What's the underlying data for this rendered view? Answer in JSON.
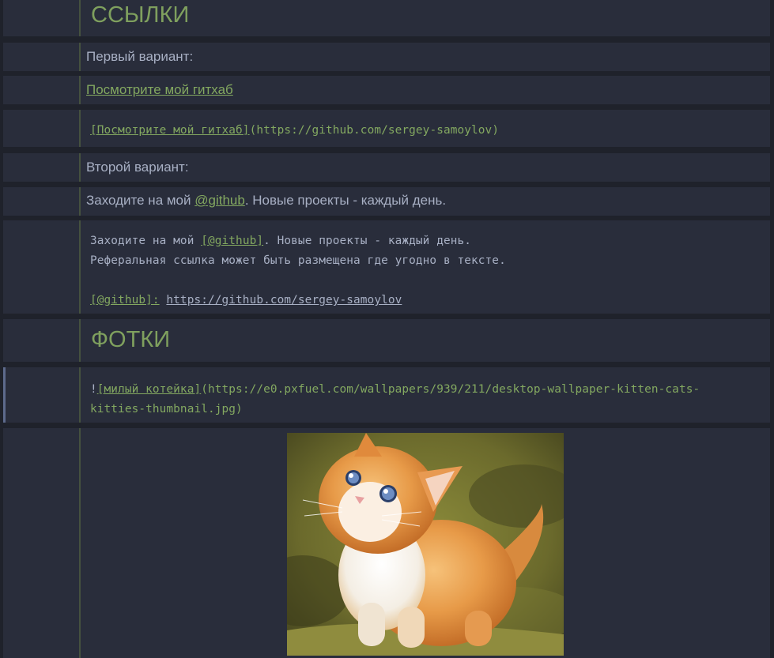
{
  "sections": {
    "links_heading": "ССЫЛКИ",
    "photos_heading": "ФОТКИ"
  },
  "links": {
    "variant1_label": "Первый вариант:",
    "variant1_link_text": "Посмотрите мой гитхаб",
    "variant1_code_link": "[Посмотрите мой гитхаб]",
    "variant1_code_url": "(https://github.com/sergey-samoylov)",
    "variant2_label": "Второй вариант:",
    "variant2_prefix": "Заходите на мой ",
    "variant2_link": "@github",
    "variant2_suffix": ". Новые проекты - каждый день.",
    "code2_line1_prefix": "Заходите на мой ",
    "code2_line1_ref": "[@github]",
    "code2_line1_suffix": ". Новые проекты - каждый день.",
    "code2_line2": "Реферальная ссылка может быть размещена где угодно в тексте.",
    "code2_ref_label": "[@github]:",
    "code2_ref_url": "https://github.com/sergey-samoylov"
  },
  "photos": {
    "code_bang": "!",
    "code_alt": "[милый котейка]",
    "code_url_line1": "(https://e0.pxfuel.com/wallpapers/939/211/desktop-wallpaper-kitten-cats-",
    "code_url_line2": "kitties-thumbnail.jpg)",
    "image_alt": "милый котейка"
  },
  "colors": {
    "background": "#1f222b",
    "cell": "#292d3b",
    "accent_green": "#7fa05e",
    "text": "#a8b0c4",
    "selection_bar": "#5d6a8c"
  }
}
